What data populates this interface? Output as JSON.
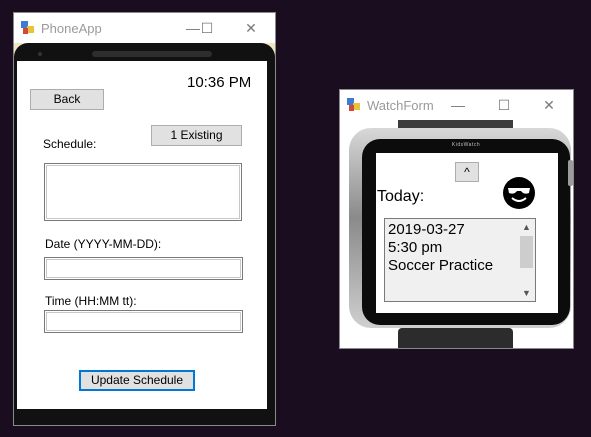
{
  "phone_window": {
    "title": "PhoneApp",
    "controls": {
      "minimize": "—",
      "maximize": "☐",
      "close": "✕"
    },
    "time": "10:36 PM",
    "back_label": "Back",
    "schedule_label": "Schedule:",
    "existing_label": "1 Existing",
    "schedule_text": "",
    "date_label": "Date (YYYY-MM-DD):",
    "date_value": "",
    "time_label": "Time (HH:MM tt):",
    "time_value": "",
    "update_label": "Update Schedule"
  },
  "watch_window": {
    "title": "WatchForm",
    "controls": {
      "minimize": "—",
      "maximize": "☐",
      "close": "✕"
    },
    "brand": "KidsWatch",
    "up_label": "^",
    "today_label": "Today:",
    "items": [
      "2019-03-27",
      "5:30 pm",
      "Soccer Practice"
    ],
    "scroll_up": "▲",
    "scroll_down": "▼"
  },
  "colors": {
    "accent_border": "#0078d7",
    "desktop": "#1a0d1f",
    "phone_bezel": "#f0e6c4"
  }
}
